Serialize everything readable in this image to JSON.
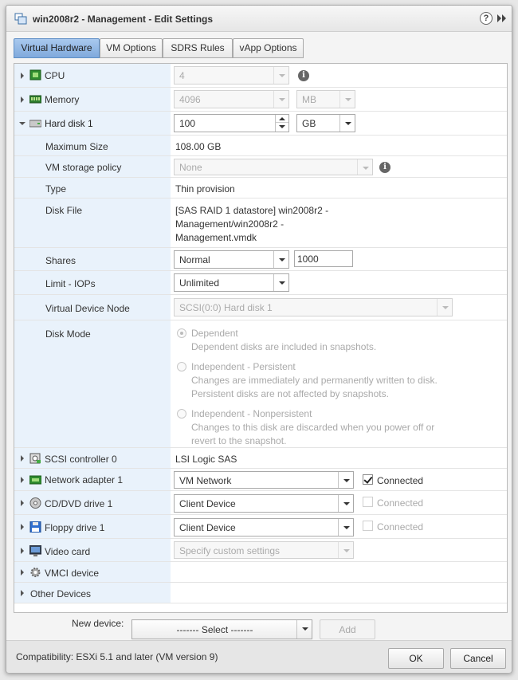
{
  "window": {
    "title": "win2008r2 - Management - Edit Settings",
    "help_label": "?"
  },
  "tabs": [
    {
      "label": "Virtual Hardware"
    },
    {
      "label": "VM Options"
    },
    {
      "label": "SDRS Rules"
    },
    {
      "label": "vApp Options"
    }
  ],
  "cpu": {
    "label": "CPU",
    "value": "4",
    "icon": "cpu-icon"
  },
  "memory": {
    "label": "Memory",
    "value": "4096",
    "unit": "MB",
    "icon": "memory-icon"
  },
  "hard_disk": {
    "label": "Hard disk 1",
    "value": "100",
    "unit": "GB",
    "icon": "hard-disk-icon",
    "max_size_label": "Maximum Size",
    "max_size": "108.00 GB",
    "storage_policy_label": "VM storage policy",
    "storage_policy": "None",
    "type_label": "Type",
    "type": "Thin provision",
    "disk_file_label": "Disk File",
    "disk_file_lines": [
      "[SAS RAID 1 datastore] win2008r2 -",
      "Management/win2008r2 -",
      "Management.vmdk"
    ],
    "shares_label": "Shares",
    "shares": "Normal",
    "shares_value": "1000",
    "limit_label": "Limit - IOPs",
    "limit": "Unlimited",
    "vdn_label": "Virtual Device Node",
    "vdn": "SCSI(0:0) Hard disk 1",
    "disk_mode_label": "Disk Mode",
    "disk_modes": [
      {
        "title": "Dependent",
        "desc": [
          "Dependent disks are included in snapshots."
        ],
        "selected": true
      },
      {
        "title": "Independent - Persistent",
        "desc": [
          "Changes are immediately and permanently written to disk.",
          "Persistent disks are not affected by snapshots."
        ],
        "selected": false
      },
      {
        "title": "Independent - Nonpersistent",
        "desc": [
          "Changes to this disk are discarded when you power off or",
          "revert to the snapshot."
        ],
        "selected": false
      }
    ]
  },
  "scsi": {
    "label": "SCSI controller 0",
    "value": "LSI Logic SAS",
    "icon": "scsi-controller-icon"
  },
  "network": {
    "label": "Network adapter 1",
    "value": "VM Network",
    "connected_label": "Connected",
    "connected": true,
    "icon": "network-adapter-icon"
  },
  "cdrom": {
    "label": "CD/DVD drive 1",
    "value": "Client Device",
    "connected_label": "Connected",
    "connected": false,
    "icon": "cd-dvd-icon"
  },
  "floppy": {
    "label": "Floppy drive 1",
    "value": "Client Device",
    "connected_label": "Connected",
    "connected": false,
    "icon": "floppy-icon"
  },
  "video": {
    "label": "Video card",
    "value": "Specify custom settings",
    "icon": "video-card-icon"
  },
  "vmci": {
    "label": "VMCI device",
    "icon": "vmci-gear-icon"
  },
  "other": {
    "label": "Other Devices"
  },
  "new_device": {
    "label": "New device:",
    "select": "------- Select -------",
    "add_label": "Add"
  },
  "footer": {
    "compatibility": "Compatibility: ESXi 5.1 and later (VM version 9)",
    "ok_label": "OK",
    "cancel_label": "Cancel"
  },
  "colors": {
    "accent": "#7fa9dc",
    "label_bg": "#e9f2fb",
    "disabled_text": "#aaaaaa"
  }
}
